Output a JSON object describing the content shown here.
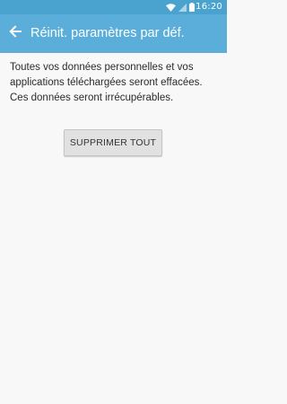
{
  "status_bar": {
    "time": "16:20",
    "icons": [
      "wifi-icon",
      "signal-icon",
      "battery-icon"
    ]
  },
  "app_bar": {
    "back_icon": "arrow-left-icon",
    "title": "Réinit. paramètres par déf."
  },
  "main": {
    "description_lines": [
      "Toutes vos données personnelles et vos",
      "applications téléchargées seront effacées.",
      "Ces données seront irrécupérables."
    ],
    "delete_button_label": "SUPPRIMER TOUT"
  },
  "colors": {
    "status_bar_bg": "#4aa2cf",
    "app_bar_bg": "#5aaed9",
    "background": "#f8f8f8",
    "button_bg": "#e1e1e1",
    "text": "#2b2b2b"
  }
}
